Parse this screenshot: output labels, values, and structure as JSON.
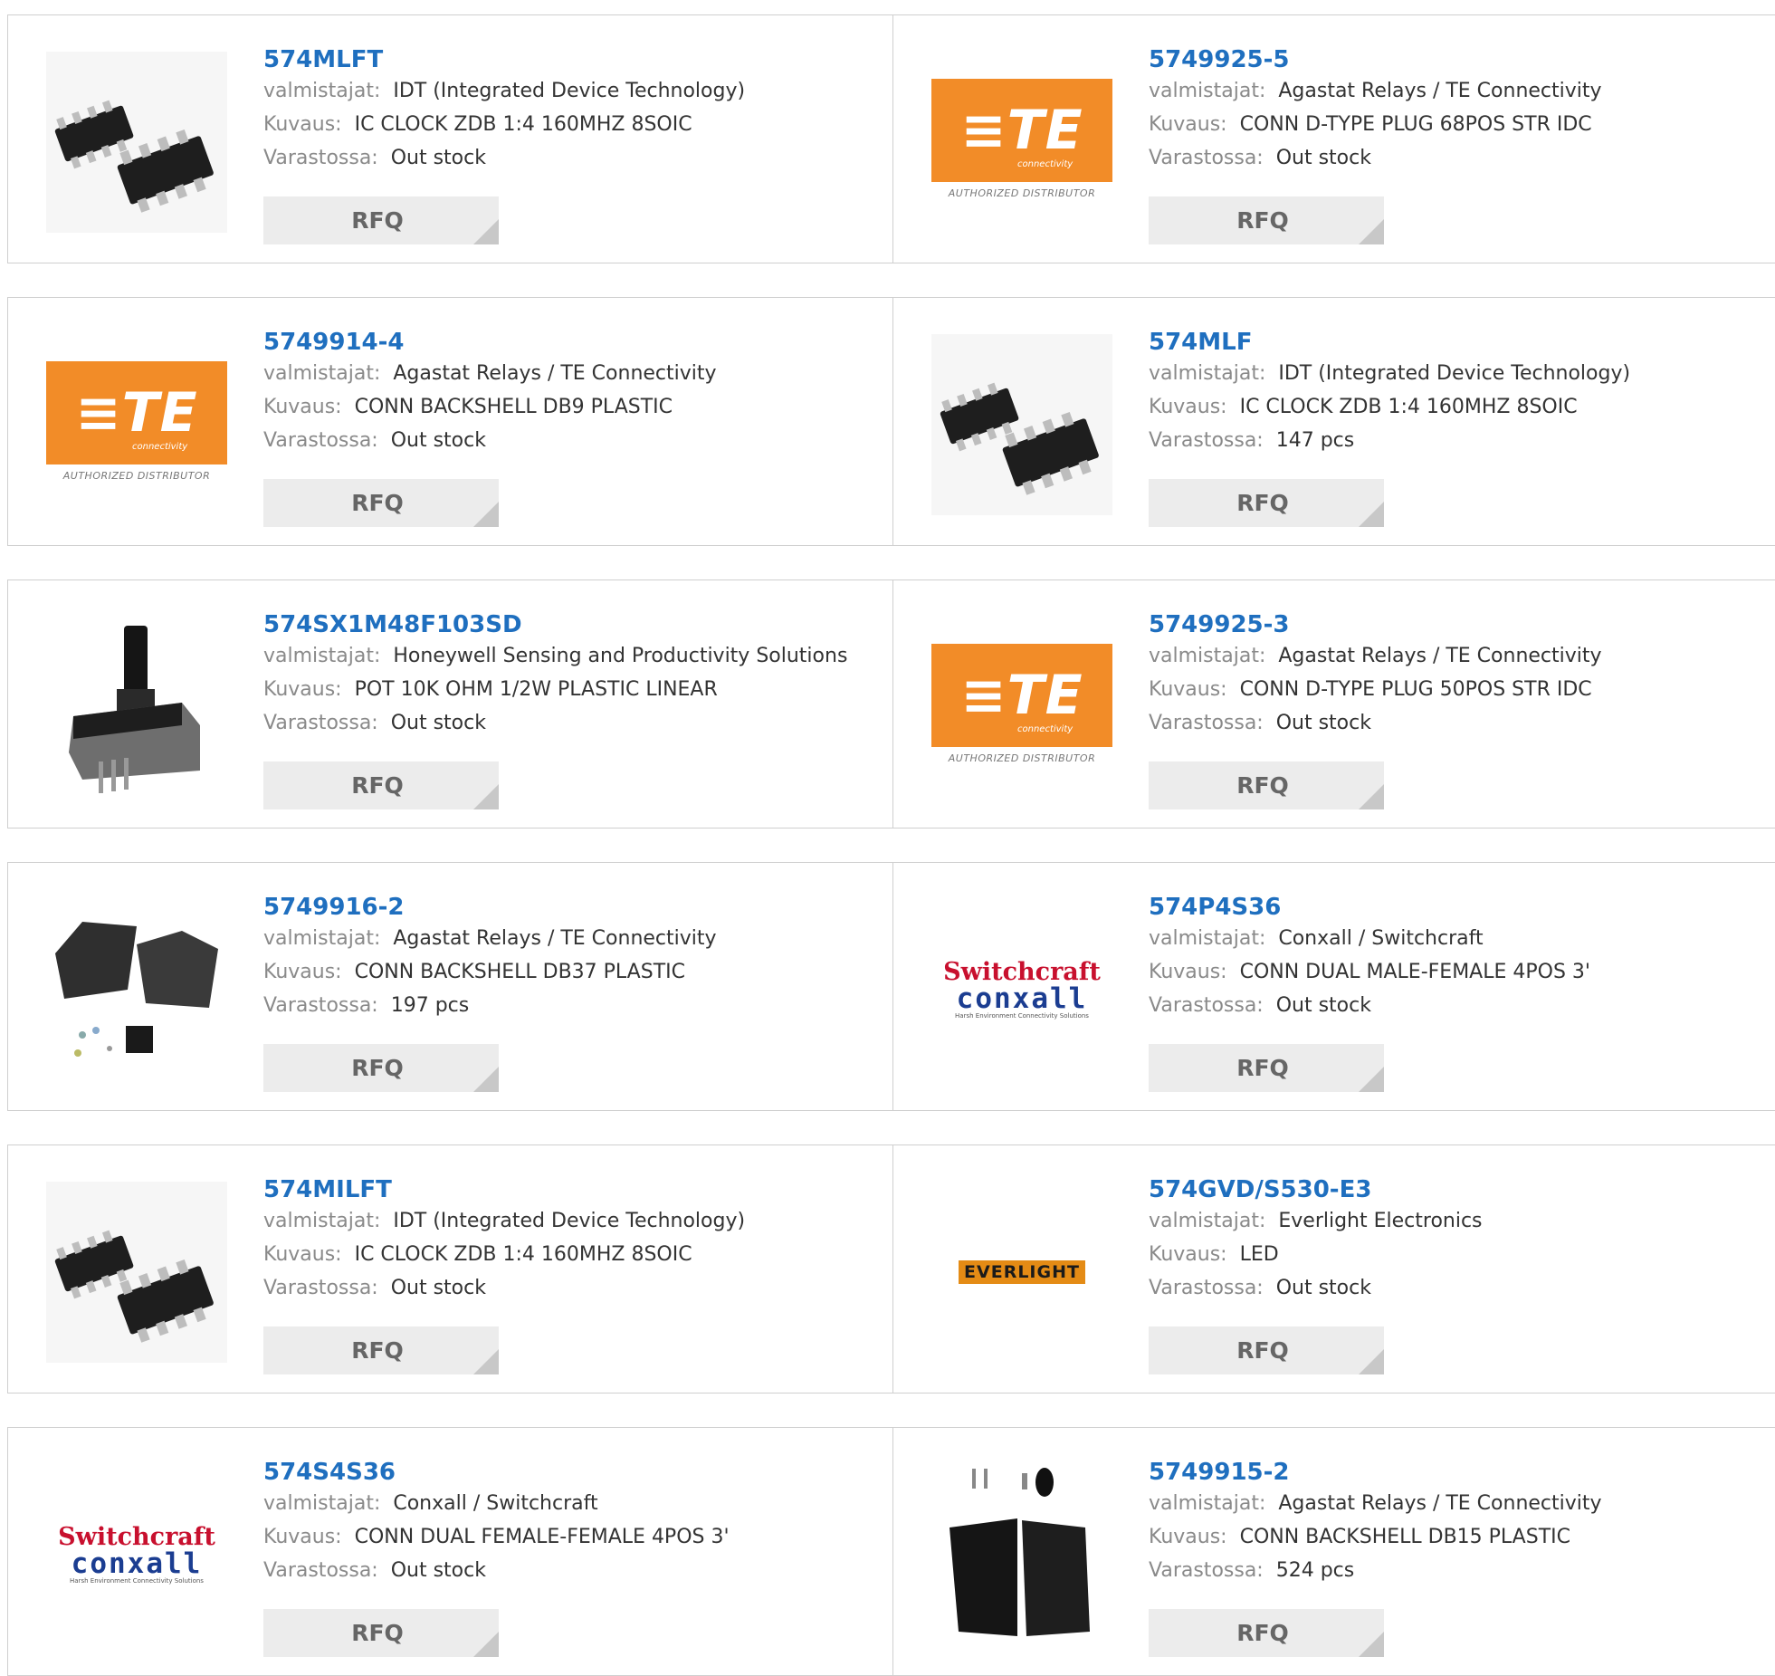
{
  "labels": {
    "manufacturer": "valmistajat:",
    "description": "Kuvaus:",
    "stock": "Varastossa:",
    "rfq": "RFQ"
  },
  "logos": {
    "te_text": "TE",
    "te_sub": "connectivity",
    "te_foot": "AUTHORIZED DISTRIBUTOR",
    "sc_top": "Switchcraft",
    "sc_mid": "conxall",
    "sc_small": "Harsh Environment Connectivity Solutions",
    "everlight": "EVERLIGHT"
  },
  "colors": {
    "link": "#1f6fbf",
    "te_orange": "#f28c28",
    "button_bg": "#ececec"
  },
  "rows": [
    {
      "left": {
        "part": "574MLFT",
        "manufacturer": "IDT (Integrated Device Technology)",
        "description": "IC CLOCK ZDB 1:4 160MHZ 8SOIC",
        "stock": "Out stock",
        "image": "soic-chip-icon"
      },
      "right": {
        "part": "5749925-5",
        "manufacturer": "Agastat Relays / TE Connectivity",
        "description": "CONN D-TYPE PLUG 68POS STR IDC",
        "stock": "Out stock",
        "image": "te-logo"
      }
    },
    {
      "left": {
        "part": "5749914-4",
        "manufacturer": "Agastat Relays / TE Connectivity",
        "description": "CONN BACKSHELL DB9 PLASTIC",
        "stock": "Out stock",
        "image": "te-logo"
      },
      "right": {
        "part": "574MLF",
        "manufacturer": "IDT (Integrated Device Technology)",
        "description": "IC CLOCK ZDB 1:4 160MHZ 8SOIC",
        "stock": "147 pcs",
        "image": "soic-chip-icon"
      }
    },
    {
      "left": {
        "part": "574SX1M48F103SD",
        "manufacturer": "Honeywell Sensing and Productivity Solutions",
        "description": "POT 10K OHM 1/2W PLASTIC LINEAR",
        "stock": "Out stock",
        "image": "potentiometer-icon"
      },
      "right": {
        "part": "5749925-3",
        "manufacturer": "Agastat Relays / TE Connectivity",
        "description": "CONN D-TYPE PLUG 50POS STR IDC",
        "stock": "Out stock",
        "image": "te-logo"
      }
    },
    {
      "left": {
        "part": "5749916-2",
        "manufacturer": "Agastat Relays / TE Connectivity",
        "description": "CONN BACKSHELL DB37 PLASTIC",
        "stock": "197 pcs",
        "image": "backshell-icon"
      },
      "right": {
        "part": "574P4S36",
        "manufacturer": "Conxall / Switchcraft",
        "description": "CONN DUAL MALE-FEMALE 4POS 3'",
        "stock": "Out stock",
        "image": "switchcraft-logo"
      }
    },
    {
      "left": {
        "part": "574MILFT",
        "manufacturer": "IDT (Integrated Device Technology)",
        "description": "IC CLOCK ZDB 1:4 160MHZ 8SOIC",
        "stock": "Out stock",
        "image": "soic-chip-icon"
      },
      "right": {
        "part": "574GVD/S530-E3",
        "manufacturer": "Everlight Electronics",
        "description": "LED",
        "stock": "Out stock",
        "image": "everlight-logo"
      }
    },
    {
      "left": {
        "part": "574S4S36",
        "manufacturer": "Conxall / Switchcraft",
        "description": "CONN DUAL FEMALE-FEMALE 4POS 3'",
        "stock": "Out stock",
        "image": "switchcraft-logo"
      },
      "right": {
        "part": "5749915-2",
        "manufacturer": "Agastat Relays / TE Connectivity",
        "description": "CONN BACKSHELL DB15 PLASTIC",
        "stock": "524 pcs",
        "image": "backshell-black-icon"
      }
    }
  ]
}
